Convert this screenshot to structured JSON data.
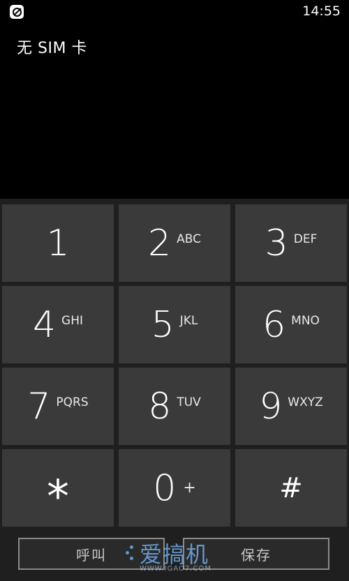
{
  "status_bar": {
    "icon": "data-sense-icon",
    "time": "14:55"
  },
  "sim_status": "无 SIM 卡",
  "keypad": {
    "keys": [
      {
        "digit": "1",
        "letters": ""
      },
      {
        "digit": "2",
        "letters": "ABC"
      },
      {
        "digit": "3",
        "letters": "DEF"
      },
      {
        "digit": "4",
        "letters": "GHI"
      },
      {
        "digit": "5",
        "letters": "JKL"
      },
      {
        "digit": "6",
        "letters": "MNO"
      },
      {
        "digit": "7",
        "letters": "PQRS"
      },
      {
        "digit": "8",
        "letters": "TUV"
      },
      {
        "digit": "9",
        "letters": "WXYZ"
      },
      {
        "digit": "*",
        "letters": ""
      },
      {
        "digit": "0",
        "letters": "+"
      },
      {
        "digit": "#",
        "letters": ""
      }
    ]
  },
  "actions": {
    "call_label": "呼叫",
    "save_label": "保存"
  },
  "watermark": {
    "text": "爱搞机",
    "url": "WWW.IGAO7.COM"
  }
}
